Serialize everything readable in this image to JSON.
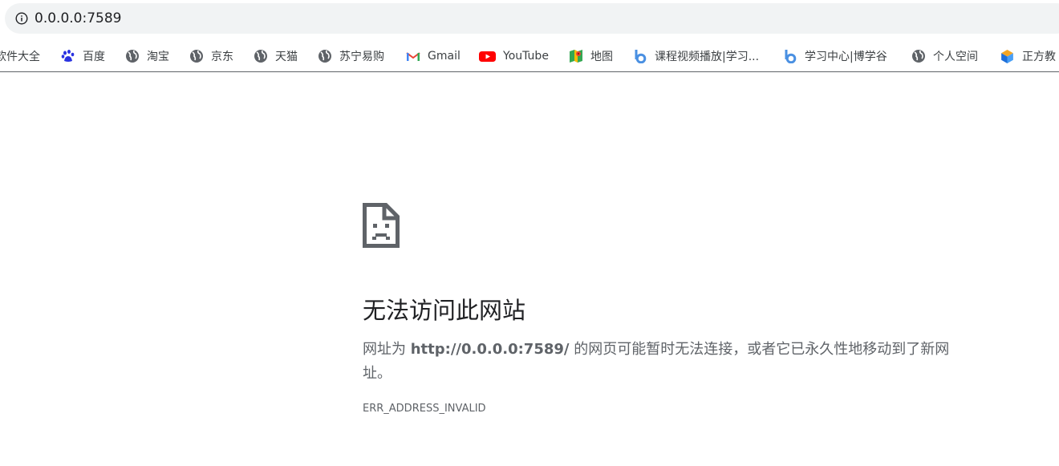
{
  "address_bar": {
    "url": "0.0.0.0:7589",
    "icon": "info-icon"
  },
  "bookmarks": [
    {
      "label": "软件大全",
      "icon": "none"
    },
    {
      "label": "百度",
      "icon": "baidu-paw-icon"
    },
    {
      "label": "淘宝",
      "icon": "globe-icon"
    },
    {
      "label": "京东",
      "icon": "globe-icon"
    },
    {
      "label": "天猫",
      "icon": "globe-icon"
    },
    {
      "label": "苏宁易购",
      "icon": "globe-icon"
    },
    {
      "label": "Gmail",
      "icon": "gmail-icon"
    },
    {
      "label": "YouTube",
      "icon": "youtube-icon"
    },
    {
      "label": "地图",
      "icon": "maps-icon"
    },
    {
      "label": "课程视频播放|学习...",
      "icon": "b-logo-icon"
    },
    {
      "label": "学习中心|博学谷",
      "icon": "b-logo-icon"
    },
    {
      "label": "个人空间",
      "icon": "globe-icon"
    },
    {
      "label": "正方教",
      "icon": "cube-icon"
    }
  ],
  "error_page": {
    "icon": "sad-page-icon",
    "title": "无法访问此网站",
    "desc_prefix": "网址为 ",
    "desc_url": "http://0.0.0.0:7589/",
    "desc_suffix": " 的网页可能暂时无法连接，或者它已永久性地移动到了新网址。",
    "error_code": "ERR_ADDRESS_INVALID"
  },
  "colors": {
    "omnibox_bg": "#f1f3f4",
    "text_primary": "#202124",
    "text_secondary": "#5f6368",
    "youtube_red": "#ff0000"
  }
}
